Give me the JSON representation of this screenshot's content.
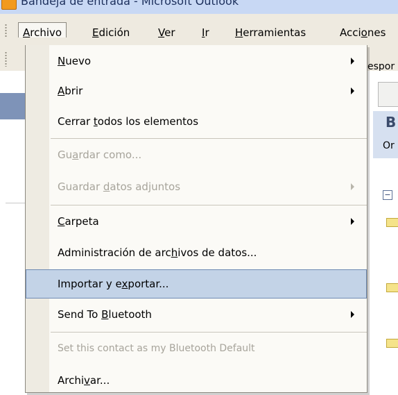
{
  "window": {
    "title": "Bandeja de entrada - Microsoft Outlook"
  },
  "menubar": {
    "items": [
      {
        "label_pre": "",
        "label_ul": "A",
        "label_post": "rchivo"
      },
      {
        "label_pre": "",
        "label_ul": "E",
        "label_post": "dición"
      },
      {
        "label_pre": "",
        "label_ul": "V",
        "label_post": "er"
      },
      {
        "label_pre": "",
        "label_ul": "I",
        "label_post": "r"
      },
      {
        "label_pre": "",
        "label_ul": "H",
        "label_post": "erramientas"
      },
      {
        "label_pre": "Acci",
        "label_ul": "o",
        "label_post": "nes"
      }
    ]
  },
  "background": {
    "toolbar_text": "espor",
    "pane_header_letter": "B",
    "pane_header_sub": "Or",
    "collapse_glyph": "−"
  },
  "file_menu": {
    "items": [
      {
        "pre": "",
        "ul": "N",
        "post": "uevo"
      },
      {
        "pre": "",
        "ul": "A",
        "post": "brir"
      },
      {
        "pre": "Cerrar ",
        "ul": "t",
        "post": "odos los elementos"
      },
      {
        "pre": "Gu",
        "ul": "a",
        "post": "rdar como..."
      },
      {
        "pre": "Guardar ",
        "ul": "d",
        "post": "atos adjuntos"
      },
      {
        "pre": "",
        "ul": "C",
        "post": "arpeta"
      },
      {
        "pre": "Administración de arc",
        "ul": "h",
        "post": "ivos de datos..."
      },
      {
        "pre": "Importar y e",
        "ul": "x",
        "post": "portar..."
      },
      {
        "pre": "Send To ",
        "ul": "B",
        "post": "luetooth"
      },
      {
        "pre": "Set this contact as my Bluetooth Default",
        "ul": "",
        "post": ""
      },
      {
        "pre": "Archi",
        "ul": "v",
        "post": "ar..."
      }
    ]
  }
}
